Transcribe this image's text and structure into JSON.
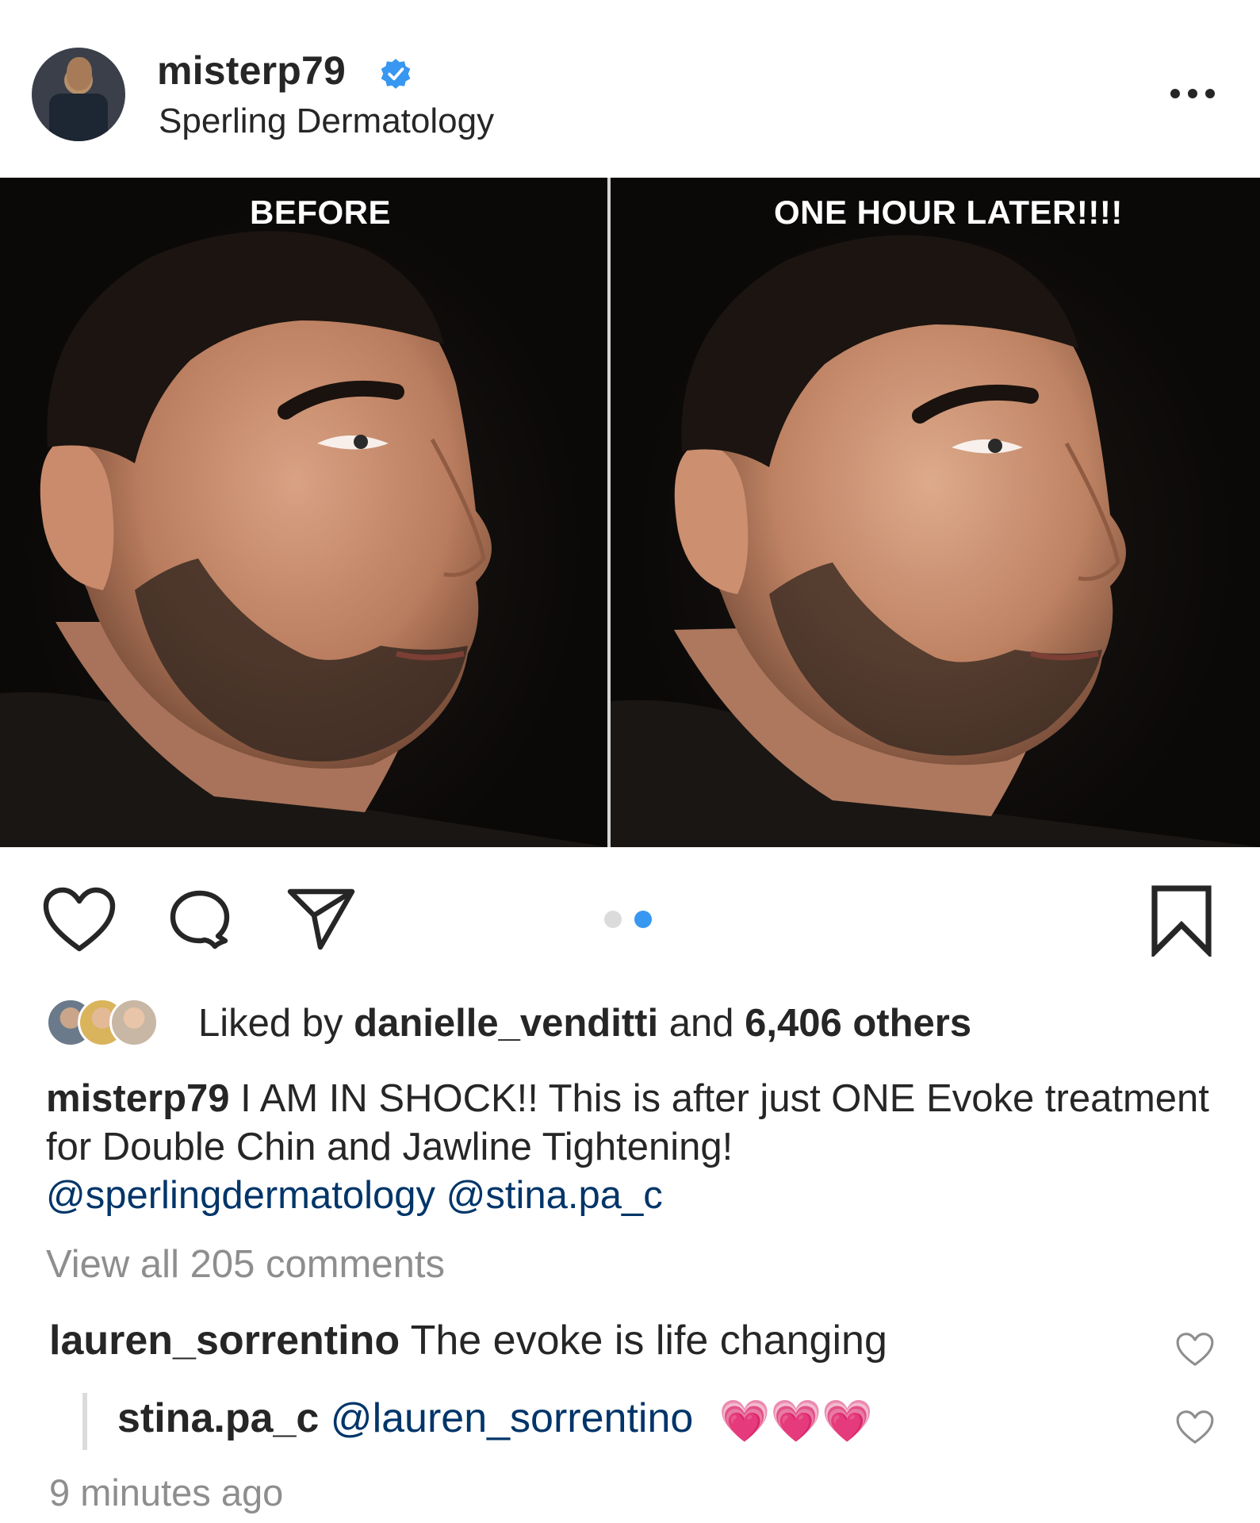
{
  "post": {
    "username": "misterp79",
    "location": "Sperling Dermatology",
    "verified": true
  },
  "icons": {
    "more": "more-options-icon",
    "like": "heart-icon",
    "comment": "comment-icon",
    "share": "paper-plane-icon",
    "save": "bookmark-icon"
  },
  "photo": {
    "left_label": "BEFORE",
    "right_label": "ONE HOUR LATER!!!!"
  },
  "carousel": {
    "count": 2,
    "active_index": 2,
    "active_color": "#3897f0",
    "inactive_color": "#dbdbdb"
  },
  "likes": {
    "prefix": "Liked by",
    "user": "danielle_venditti",
    "conjunction": "and",
    "others": "6,406 others"
  },
  "caption": {
    "user": "misterp79",
    "text": " I AM IN SHOCK!! This is after just ONE Evoke treatment for Double Chin and Jawline Tightening!",
    "mention1": "@sperlingdermatology",
    "mention2": "@stina.pa_c"
  },
  "view_all": "View all 205 comments",
  "comments": [
    {
      "user": "lauren_sorrentino",
      "text": " The evoke is life changing"
    },
    {
      "user": "stina.pa_c",
      "mention": "@lauren_sorrentino",
      "emoji": "💗💗💗"
    }
  ],
  "timestamp": "9 minutes ago",
  "colors": {
    "text": "#262626",
    "muted": "#8e8e8e",
    "mention": "#003569",
    "verified": "#3897f0"
  }
}
